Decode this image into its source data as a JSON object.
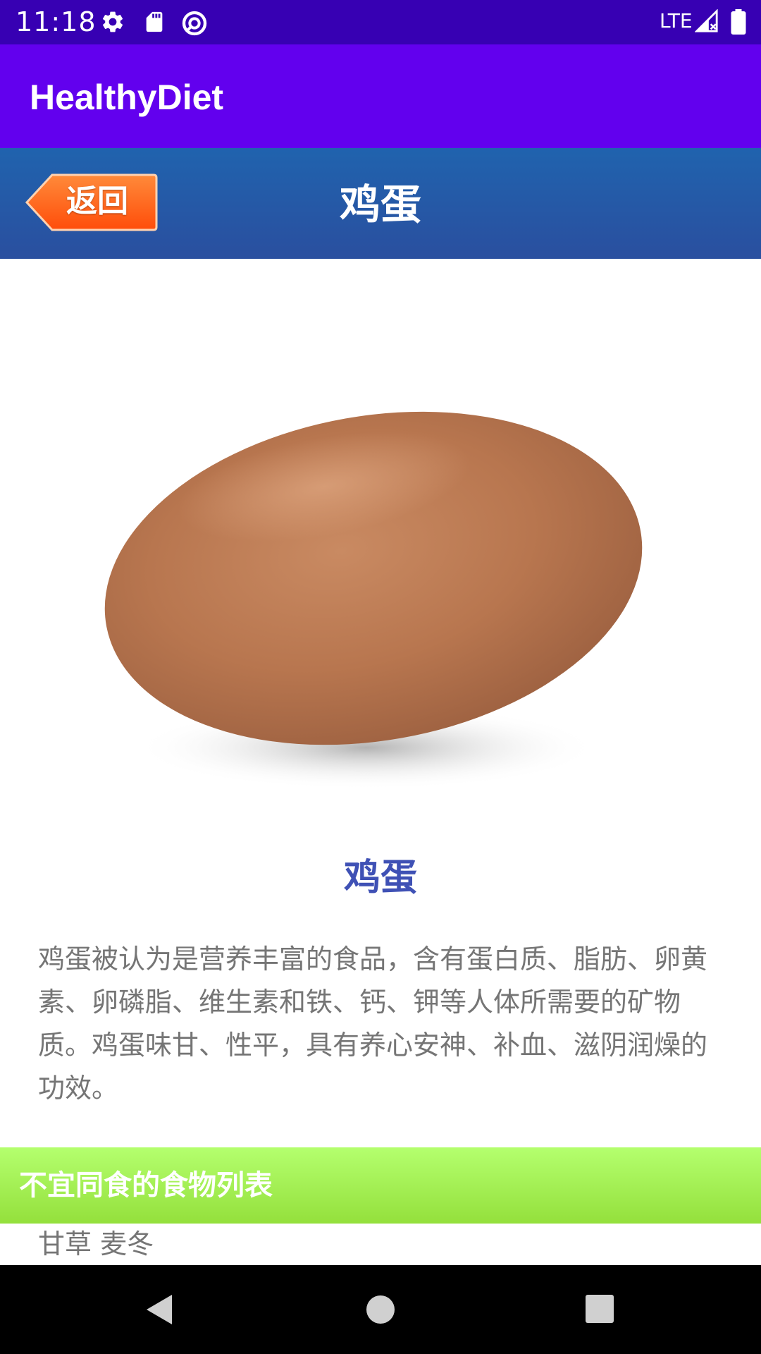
{
  "status_bar": {
    "time": "11:18",
    "network": "LTE",
    "icons": [
      "gear-icon",
      "sd-card-icon",
      "data-saver-icon",
      "signal-icon",
      "battery-icon"
    ]
  },
  "app_bar": {
    "title": "HealthyDiet",
    "color": "#6200ee"
  },
  "title_bar": {
    "back_label": "返回",
    "title": "鸡蛋"
  },
  "food": {
    "image_icon": "egg-photo",
    "name": "鸡蛋",
    "description": "鸡蛋被认为是营养丰富的食品，含有蛋白质、脂肪、卵黄素、卵磷脂、维生素和铁、钙、钾等人体所需要的矿物质。鸡蛋味甘、性平，具有养心安神、补血、滋阴润燥的功效。"
  },
  "avoid_section": {
    "header": "不宜同食的食物列表",
    "items_text": "甘草 麦冬"
  },
  "nav_bar": {
    "icons": [
      "back-icon",
      "home-icon",
      "recents-icon"
    ]
  }
}
